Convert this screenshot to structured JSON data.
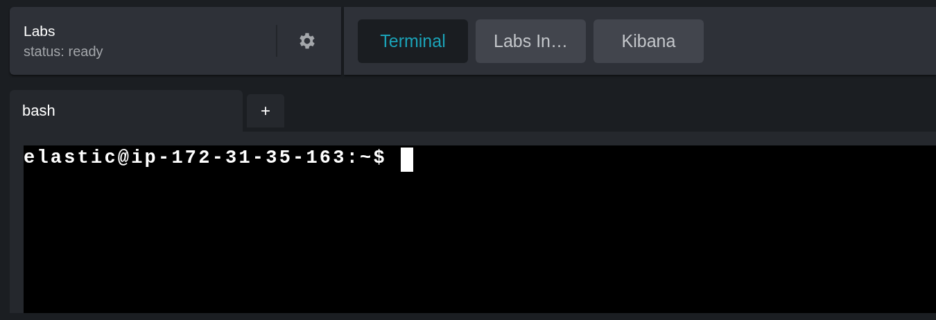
{
  "lab": {
    "title": "Labs",
    "status": "status: ready"
  },
  "views": [
    {
      "label": "Terminal",
      "selected": true
    },
    {
      "label": "Labs In…",
      "selected": false
    },
    {
      "label": "Kibana",
      "selected": false
    }
  ],
  "sessions": [
    {
      "label": "bash",
      "selected": true
    }
  ],
  "new_session": "+",
  "terminal": {
    "prompt": "elastic@ip-172-31-35-163:~$"
  }
}
